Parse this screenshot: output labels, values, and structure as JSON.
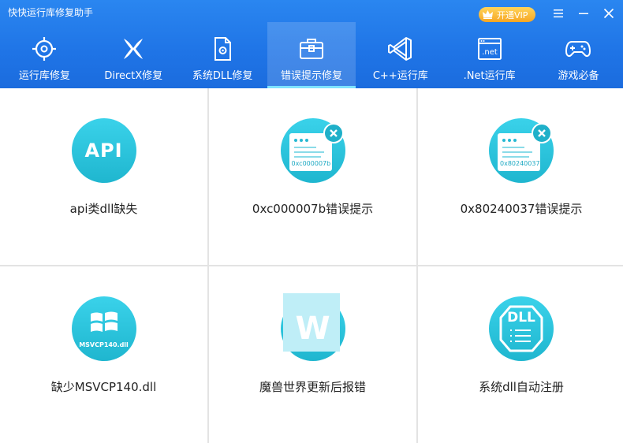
{
  "app": {
    "title": "快快运行库修复助手",
    "vip_label": "开通VIP"
  },
  "colors": {
    "header": "#1f74e6",
    "accent": "#26c3dd",
    "vip": "#f7a623"
  },
  "tabs": [
    {
      "label": "运行库修复",
      "icon": "target-icon",
      "active": false
    },
    {
      "label": "DirectX修复",
      "icon": "directx-icon",
      "active": false
    },
    {
      "label": "系统DLL修复",
      "icon": "dll-file-icon",
      "active": false
    },
    {
      "label": "错误提示修复",
      "icon": "toolbox-icon",
      "active": true
    },
    {
      "label": "C++运行库",
      "icon": "visual-studio-icon",
      "active": false
    },
    {
      "label": ".Net运行库",
      "icon": "dotnet-icon",
      "active": false
    },
    {
      "label": "游戏必备",
      "icon": "gamepad-icon",
      "active": false
    }
  ],
  "cards": [
    {
      "label": "api类dll缺失",
      "icon": "api-icon",
      "icon_text": "API"
    },
    {
      "label": "0xc000007b错误提示",
      "icon": "error-window-icon",
      "icon_text": "0xc000007b"
    },
    {
      "label": "0x80240037错误提示",
      "icon": "error-window-icon",
      "icon_text": "0x80240037"
    },
    {
      "label": "缺少MSVCP140.dll",
      "icon": "windows-logo-icon",
      "icon_text": "MSVCP140.dll"
    },
    {
      "label": "魔兽世界更新后报错",
      "icon": "wow-icon",
      "icon_text": "W"
    },
    {
      "label": "系统dll自动注册",
      "icon": "dll-shield-icon",
      "icon_text": "DLL"
    }
  ]
}
